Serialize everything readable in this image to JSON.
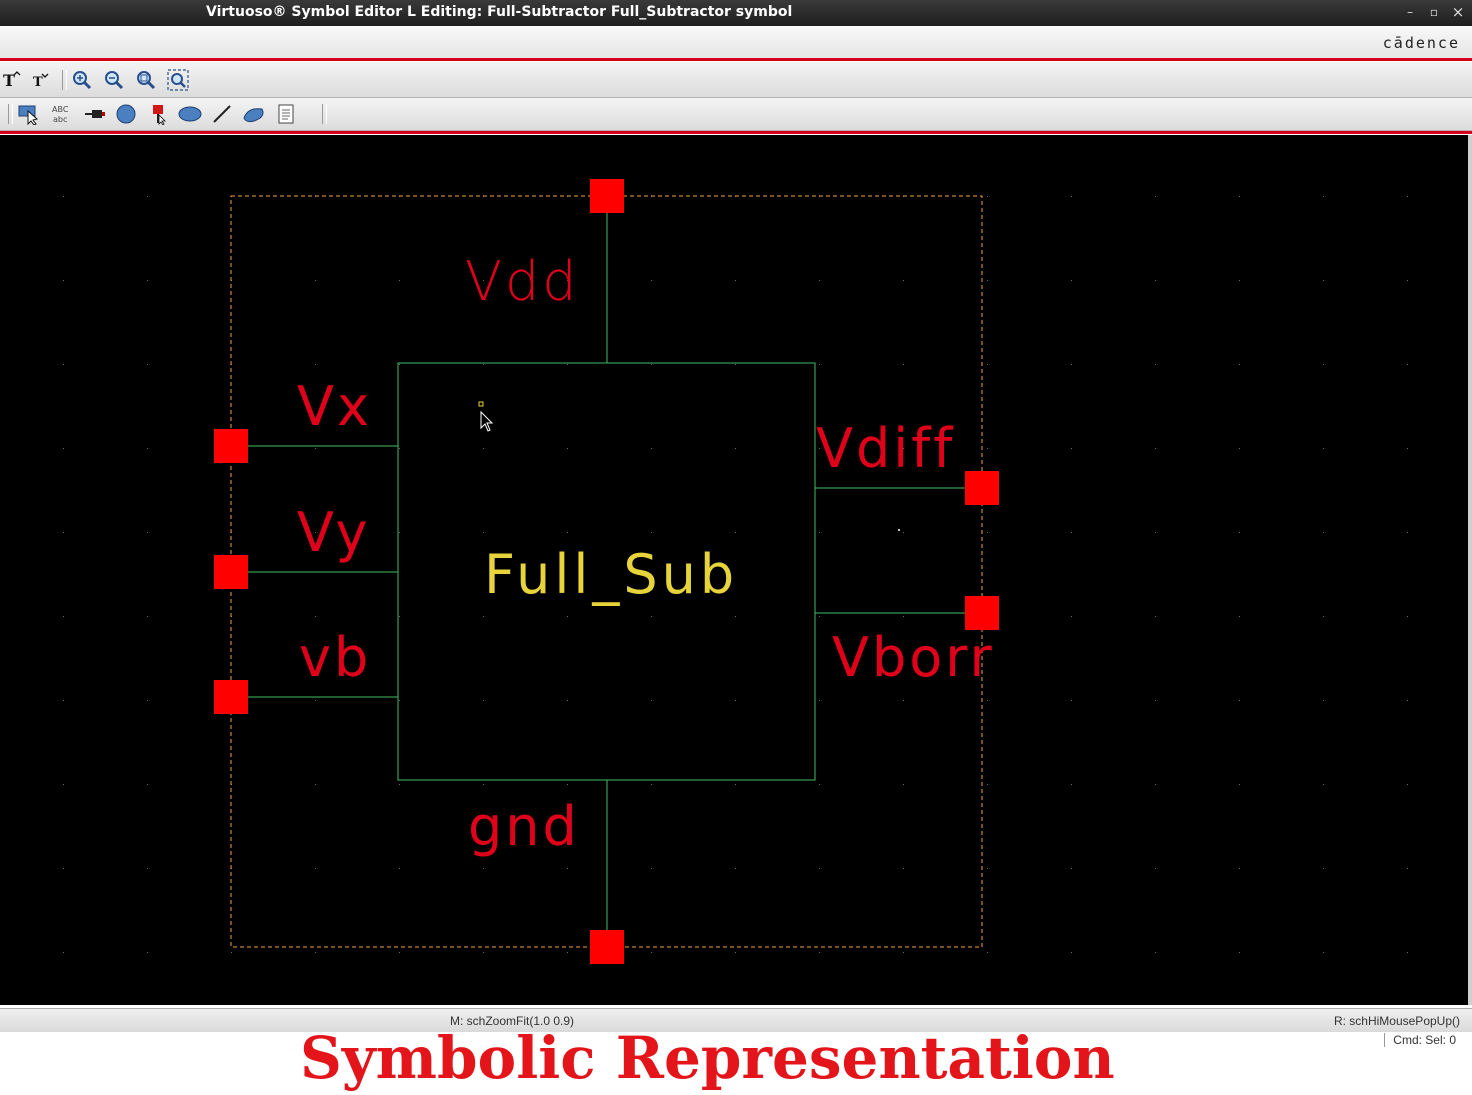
{
  "window": {
    "title": "Virtuoso® Symbol Editor L Editing: Full-Subtractor Full_Subtractor symbol",
    "minimize_glyph": "–",
    "maximize_glyph": "▫",
    "close_glyph": "×"
  },
  "brand": {
    "logo_text": "cādence"
  },
  "toolbar_top": {
    "items": [
      "text-size-increase-icon",
      "text-size-decrease-icon",
      "zoom-in-icon",
      "zoom-out-icon",
      "zoom-area-icon",
      "zoom-fit-icon"
    ]
  },
  "toolbar_bottom": {
    "items": [
      "select-icon",
      "label-abc-icon",
      "pin-icon",
      "circle-shape-icon",
      "red-pin-icon",
      "ellipse-icon",
      "line-icon",
      "arc-icon",
      "notepad-icon"
    ]
  },
  "symbol": {
    "body_label": "Full_Sub",
    "pins": {
      "top": "Vdd",
      "bottom": "gnd",
      "left": [
        "Vx",
        "Vy",
        "vb"
      ],
      "right": [
        "Vdiff",
        "Vborr"
      ]
    }
  },
  "status": {
    "mouse_left": "M: schZoomFit(1.0 0.9)",
    "mouse_right": "R: schHiMousePopUp()",
    "cmd": "Cmd: Sel: 0"
  },
  "caption": "Symbolic Representation",
  "colors": {
    "canvas_bg": "#000000",
    "wire": "#3fbf5f",
    "pin": "#ff0000",
    "pin_label": "#e0001a",
    "body_label": "#e6d43a",
    "selection_box": "#f5a040",
    "accent_red": "#d2001c"
  }
}
